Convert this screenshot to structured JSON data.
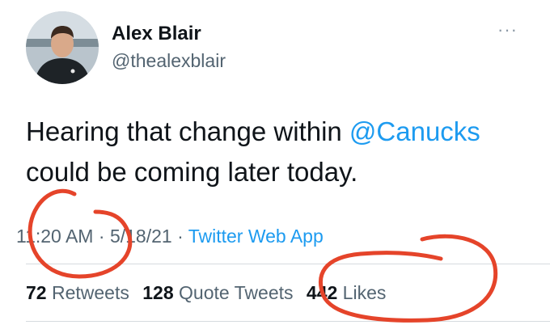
{
  "author": {
    "name": "Alex Blair",
    "handle": "@thealexblair"
  },
  "tweet": {
    "text_before": "Hearing that change within ",
    "mention": "@Canucks",
    "text_after": " could be coming later today."
  },
  "meta": {
    "time": "11:20 AM",
    "separator1": " · ",
    "date": "5/18/21",
    "separator2": " · ",
    "source": "Twitter Web App"
  },
  "stats": {
    "retweets_count": "72",
    "retweets_label": "Retweets",
    "quotes_count": "128",
    "quotes_label": "Quote Tweets",
    "likes_count": "442",
    "likes_label": "Likes"
  },
  "more_menu": "···",
  "colors": {
    "link": "#1d9bf0",
    "annotation": "#e5442a"
  }
}
